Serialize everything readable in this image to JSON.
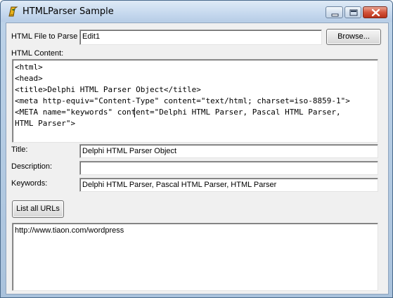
{
  "window": {
    "title": "HTMLParser Sample",
    "icon": "delphi-helmet-icon",
    "controls": [
      "minimize-icon",
      "maximize-icon",
      "close-icon"
    ]
  },
  "file": {
    "label": "HTML File to Parse",
    "value": "Edit1",
    "browse_label": "Browse..."
  },
  "content": {
    "label": "HTML Content:",
    "lines": [
      "<html>",
      "<head>",
      "<title>Delphi HTML Parser Object</title>",
      "<meta http-equiv=\"Content-Type\" content=\"text/html; charset=iso-8859-1\">",
      "<META name=\"keywords\" content=\"Delphi HTML Parser, Pascal HTML Parser,",
      "HTML Parser\">"
    ]
  },
  "fields": {
    "title_label": "Title:",
    "title_value": "Delphi HTML Parser Object",
    "description_label": "Description:",
    "description_value": "",
    "keywords_label": "Keywords:",
    "keywords_value": "Delphi HTML Parser, Pascal HTML Parser, HTML Parser"
  },
  "urls": {
    "button_label": "List all URLs",
    "items": [
      "http://www.tiaon.com/wordpress"
    ]
  },
  "colors": {
    "title_bar": "#c6d9ee",
    "close_button": "#d4553c",
    "form_background": "#f0f0f0"
  }
}
